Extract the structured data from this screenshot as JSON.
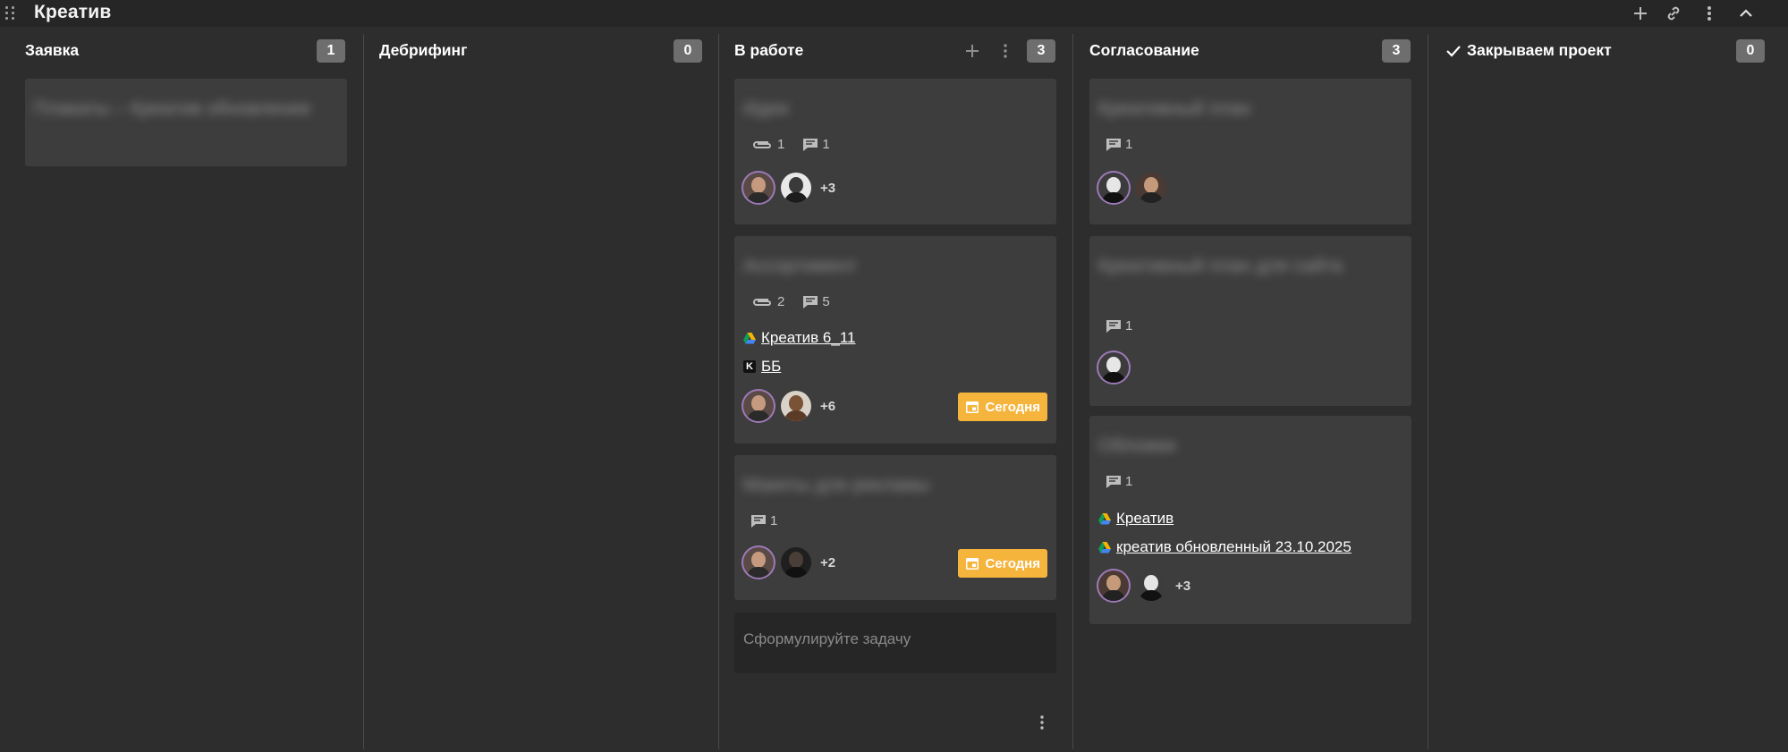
{
  "board": {
    "title": "Креатив",
    "toolbar_icons": [
      "plus-icon",
      "link-icon",
      "more-vertical-icon",
      "chevron-up-icon"
    ]
  },
  "columns": [
    {
      "title": "Заявка",
      "count": "1",
      "cards": [
        {
          "title": "Плакаты – Креатив обновление"
        }
      ]
    },
    {
      "title": "Дебрифинг",
      "count": "0",
      "cards": []
    },
    {
      "title": "В работе",
      "count": "3",
      "cards": [
        {
          "title": "Идеи",
          "attachments": "1",
          "comments": "1",
          "extra_assignees": "+3"
        },
        {
          "title": "Ассортимент",
          "attachments": "2",
          "comments": "5",
          "links": [
            {
              "icon": "google-drive-icon",
              "text": "Креатив 6_11"
            },
            {
              "icon": "k-icon",
              "text": "ББ"
            }
          ],
          "extra_assignees": "+6",
          "due": "Сегодня"
        },
        {
          "title": "Макеты для рекламы",
          "comments": "1",
          "extra_assignees": "+2",
          "due": "Сегодня"
        }
      ],
      "new_task_placeholder": "Сформулируйте задачу"
    },
    {
      "title": "Согласование",
      "count": "3",
      "cards": [
        {
          "title": "Креативный план",
          "comments": "1"
        },
        {
          "title": "Креативный план для сайта",
          "comments": "1"
        },
        {
          "title": "Обложки",
          "comments": "1",
          "links": [
            {
              "icon": "google-drive-icon",
              "text": "Креатив"
            },
            {
              "icon": "google-drive-icon",
              "text": "креатив обновленный 23.10.2025"
            }
          ],
          "extra_assignees": "+3"
        }
      ]
    },
    {
      "title": "Закрываем проект",
      "count": "0",
      "cards": []
    }
  ],
  "colors": {
    "board_bg": "#2d2d2d",
    "topbar_bg": "#262626",
    "card_bg": "#3d3d3d",
    "count_badge": "#6e6e6e",
    "due_badge": "#f5b43c",
    "avatar_ring": "#9d7ab8"
  }
}
